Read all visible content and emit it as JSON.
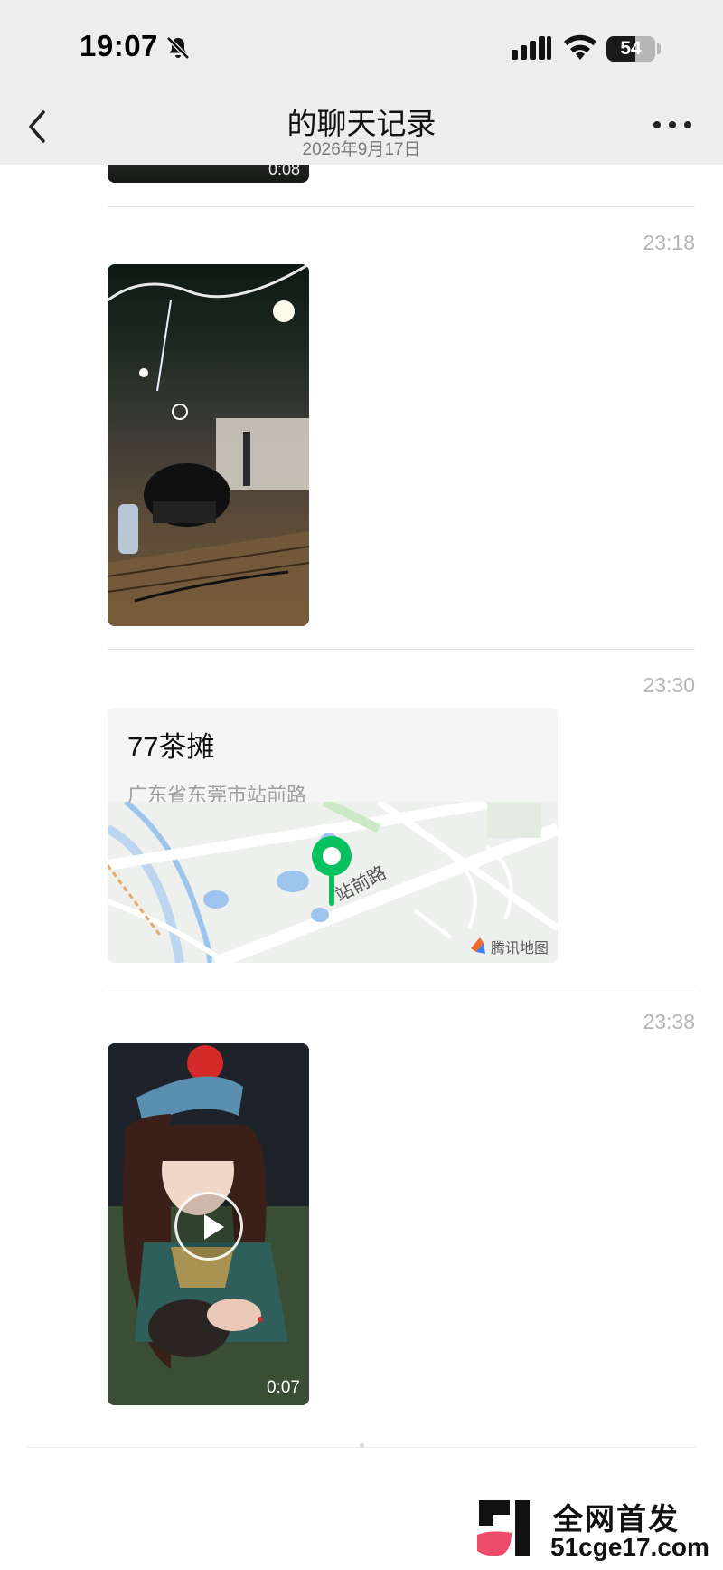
{
  "status_bar": {
    "time": "19:07",
    "battery": "54"
  },
  "header": {
    "title": "的聊天记录",
    "subtitle": "2026年9月17日"
  },
  "messages": [
    {
      "type": "video-fragment",
      "duration": "0:08"
    },
    {
      "type": "photo",
      "time": "23:18"
    },
    {
      "type": "location",
      "time": "23:30",
      "name": "77茶摊",
      "address": "广东省东莞市站前路",
      "map_road_label": "站前路",
      "map_brand": "腾讯地图"
    },
    {
      "type": "video",
      "time": "23:38",
      "duration": "0:07"
    }
  ],
  "watermark": {
    "line1": "全网首发",
    "line2": "51cge17.com"
  },
  "icons": [
    "bell-muted-icon",
    "cellular-signal-icon",
    "wifi-icon",
    "battery-icon",
    "back-chevron-icon",
    "more-dots-icon",
    "map-pin-icon",
    "play-icon",
    "tencent-map-logo-icon"
  ],
  "colors": {
    "header_bg": "#ededed",
    "pin_green": "#07c160",
    "time_gray": "#b5b5b5",
    "watermark_pink": "#ef4c6b"
  }
}
